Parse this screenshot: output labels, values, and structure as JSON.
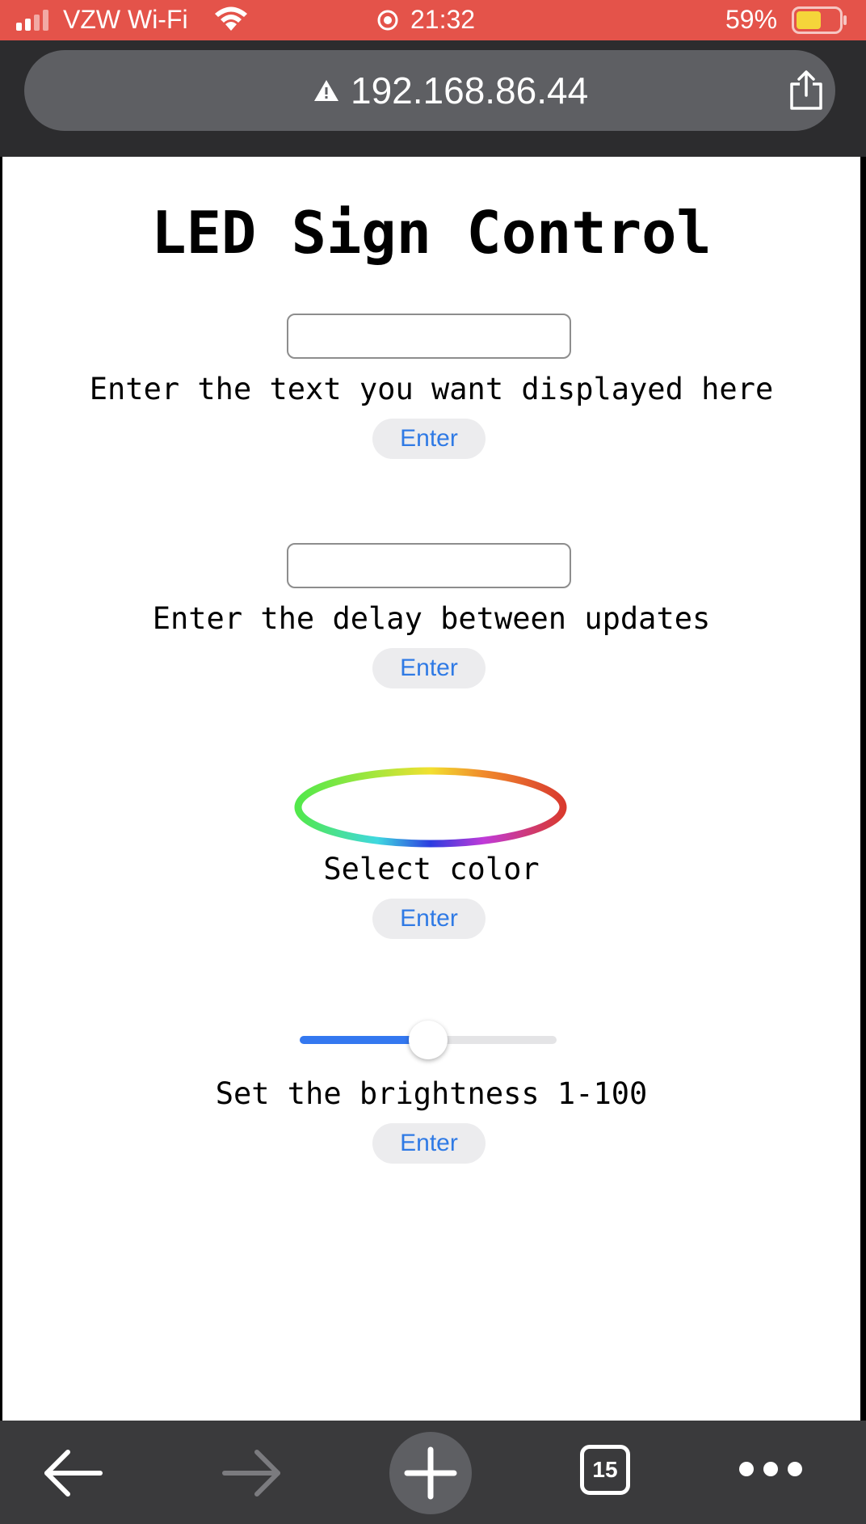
{
  "status_bar": {
    "carrier": "VZW Wi-Fi",
    "time": "21:32",
    "battery_percent": "59%",
    "battery_level": 0.59,
    "icons": [
      "signal-icon",
      "wifi-icon",
      "orientation-lock-icon",
      "battery-icon"
    ]
  },
  "address_bar": {
    "url": "192.168.86.44",
    "icons": [
      "warning-icon",
      "share-icon"
    ]
  },
  "page": {
    "title": "LED Sign Control",
    "text_section": {
      "input_value": "",
      "label": "Enter the text you want displayed here",
      "button": "Enter"
    },
    "delay_section": {
      "input_value": "",
      "label": "Enter the delay between updates",
      "button": "Enter"
    },
    "color_section": {
      "label": "Select color",
      "button": "Enter"
    },
    "brightness_section": {
      "slider_value_fraction": 0.5,
      "label": "Set the brightness 1-100",
      "button": "Enter"
    }
  },
  "toolbar": {
    "tab_count": "15",
    "icons": [
      "back-arrow-icon",
      "forward-arrow-icon",
      "plus-icon",
      "tabs-icon",
      "more-icon"
    ]
  },
  "colors": {
    "status_bar": "#e4534a",
    "chrome": "#2c2c2e",
    "url_pill": "#5e5f63",
    "toolbar": "#3a3a3c",
    "link_blue": "#2f7ae5",
    "slider_fill": "#3478f0"
  }
}
